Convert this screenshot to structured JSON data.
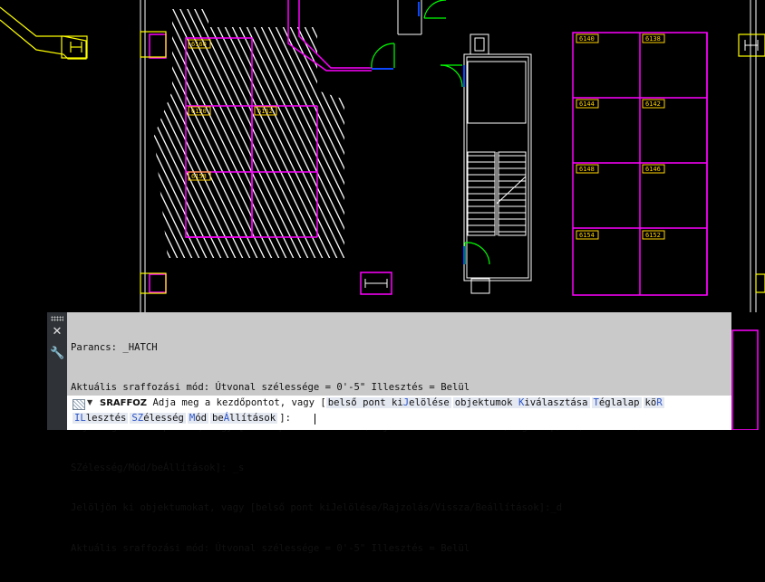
{
  "room_labels": [
    "6140",
    "6138",
    "6144",
    "6142",
    "6148",
    "6146",
    "6154",
    "6152",
    "6160",
    "6120",
    "6162",
    "6158"
  ],
  "command_window": {
    "history": [
      "Parancs: _HATCH",
      "Aktuális sraffozási mód: Útvonal szélessége = 0'-5\" Illesztés = Belül",
      "Adja meg a kezdőpontot, vagy [belső pont kiJelölése/objektumok Kiválasztása/Téglalap/köR/ILlesztés/",
      "SZélesség/Mód/beÁllítások]: _s",
      "Jelöljön ki objektumokat, vagy [belső pont kiJelölése/Rajzolás/Vissza/Beállítások]:_d",
      "Aktuális sraffozási mód: Útvonal szélessége = 0'-5\" Illesztés = Belül"
    ],
    "prompt": {
      "command": "SRAFFOZ",
      "text": "Adja meg a kezdőpontot, vagy [",
      "options_line1": [
        {
          "pre": "belső pont ki",
          "key": "J",
          "post": "elölése"
        },
        {
          "pre": "objektumok ",
          "key": "K",
          "post": "iválasztása"
        },
        {
          "pre": "",
          "key": "T",
          "post": "églalap"
        },
        {
          "pre": "kö",
          "key": "R",
          "post": ""
        }
      ],
      "options_line2": [
        {
          "pre": "",
          "key": "IL",
          "post": "lesztés"
        },
        {
          "pre": "",
          "key": "SZ",
          "post": "élesség"
        },
        {
          "pre": "",
          "key": "M",
          "post": "ód"
        },
        {
          "pre": "be",
          "key": "Á",
          "post": "llítások"
        }
      ],
      "suffix": "]:"
    }
  },
  "colors": {
    "background": "#000000",
    "walls": "#ff00ff",
    "stairs": "#ffffff",
    "doors": "#00ff00",
    "labels": "#ffd200",
    "columns": "#ffff00"
  }
}
